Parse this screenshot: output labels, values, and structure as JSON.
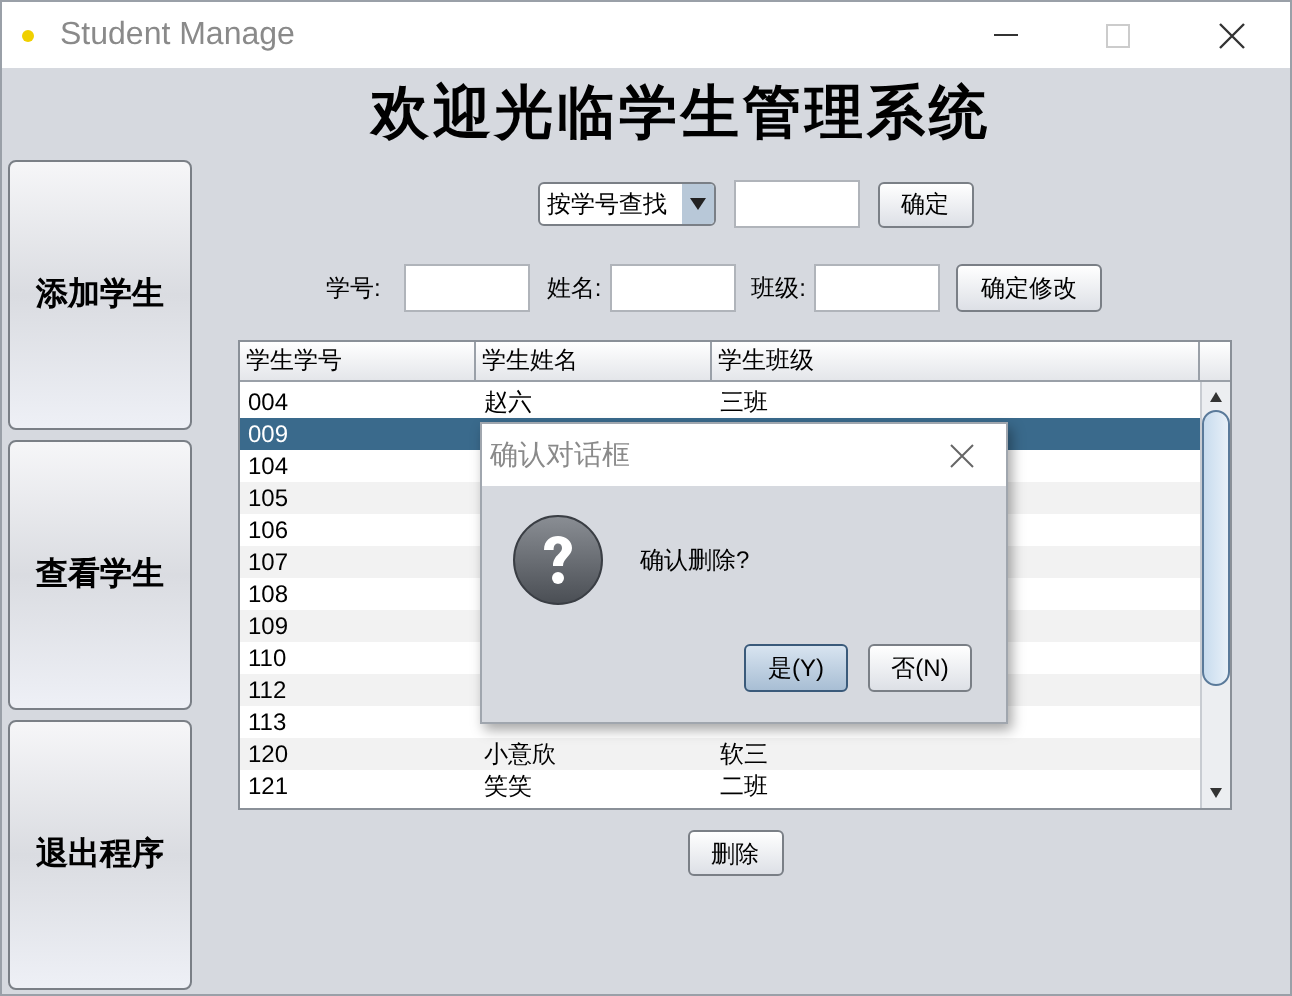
{
  "window": {
    "title": "Student Manage"
  },
  "heading": "欢迎光临学生管理系统",
  "side_buttons": [
    "添加学生",
    "查看学生",
    "退出程序"
  ],
  "search": {
    "mode": "按学号查找",
    "confirm": "确定"
  },
  "edit_form": {
    "fields": [
      {
        "label": "学号:"
      },
      {
        "label": "姓名:"
      },
      {
        "label": "班级:"
      }
    ],
    "confirm": "确定修改"
  },
  "table": {
    "columns": [
      "学生学号",
      "学生姓名",
      "学生班级"
    ],
    "rows": [
      {
        "cells": [
          "004",
          "赵六",
          "三班"
        ],
        "selected": false
      },
      {
        "cells": [
          "009"
        ],
        "selected": true
      },
      {
        "cells": [
          "104"
        ],
        "selected": false
      },
      {
        "cells": [
          "105"
        ],
        "selected": false
      },
      {
        "cells": [
          "106"
        ],
        "selected": false
      },
      {
        "cells": [
          "107"
        ],
        "selected": false
      },
      {
        "cells": [
          "108"
        ],
        "selected": false
      },
      {
        "cells": [
          "109"
        ],
        "selected": false
      },
      {
        "cells": [
          "110"
        ],
        "selected": false
      },
      {
        "cells": [
          "112"
        ],
        "selected": false
      },
      {
        "cells": [
          "113"
        ],
        "selected": false
      },
      {
        "cells": [
          "120",
          "小意欣",
          "软三"
        ],
        "selected": false
      },
      {
        "cells": [
          "121",
          "笑笑",
          "二班"
        ],
        "selected": false
      }
    ]
  },
  "delete_button": "删除",
  "dialog": {
    "title": "确认对话框",
    "message": "确认删除?",
    "buttons": [
      {
        "label": "是(Y)",
        "selected": true
      },
      {
        "label": "否(N)",
        "selected": false
      }
    ]
  }
}
